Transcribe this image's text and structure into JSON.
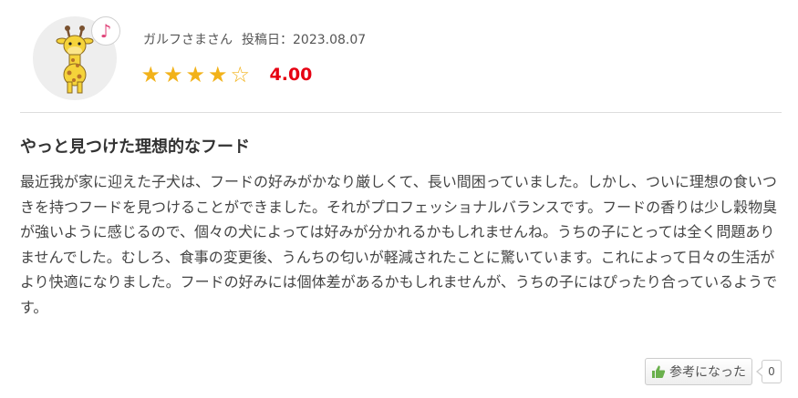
{
  "review": {
    "reviewer_name": "ガルフさまさん",
    "post_date_label": "投稿日：",
    "post_date": "2023.08.07",
    "rating": {
      "value": 4,
      "max": 5,
      "score_text": "4.00",
      "star_color": "#f2b21a",
      "score_color": "#e60012"
    },
    "avatar_icon": "giraffe-icon",
    "badge_icon": "music-note-icon",
    "badge_glyph": "♪",
    "title": "やっと見つけた理想的なフード",
    "body": "最近我が家に迎えた子犬は、フードの好みがかなり厳しくて、長い間困っていました。しかし、ついに理想の食いつきを持つフードを見つけることができました。それがプロフェッショナルバランスです。フードの香りは少し穀物臭が強いように感じるので、個々の犬によっては好みが分かれるかもしれませんね。うちの子にとっては全く問題ありませんでした。むしろ、食事の変更後、うんちの匂いが軽減されたことに驚いています。これによって日々の生活がより快適になりました。フードの好みには個体差があるかもしれませんが、うちの子にはぴったり合っているようです。"
  },
  "actions": {
    "helpful_label": "参考になった",
    "helpful_icon": "thumbs-up-icon",
    "helpful_count": "0"
  }
}
